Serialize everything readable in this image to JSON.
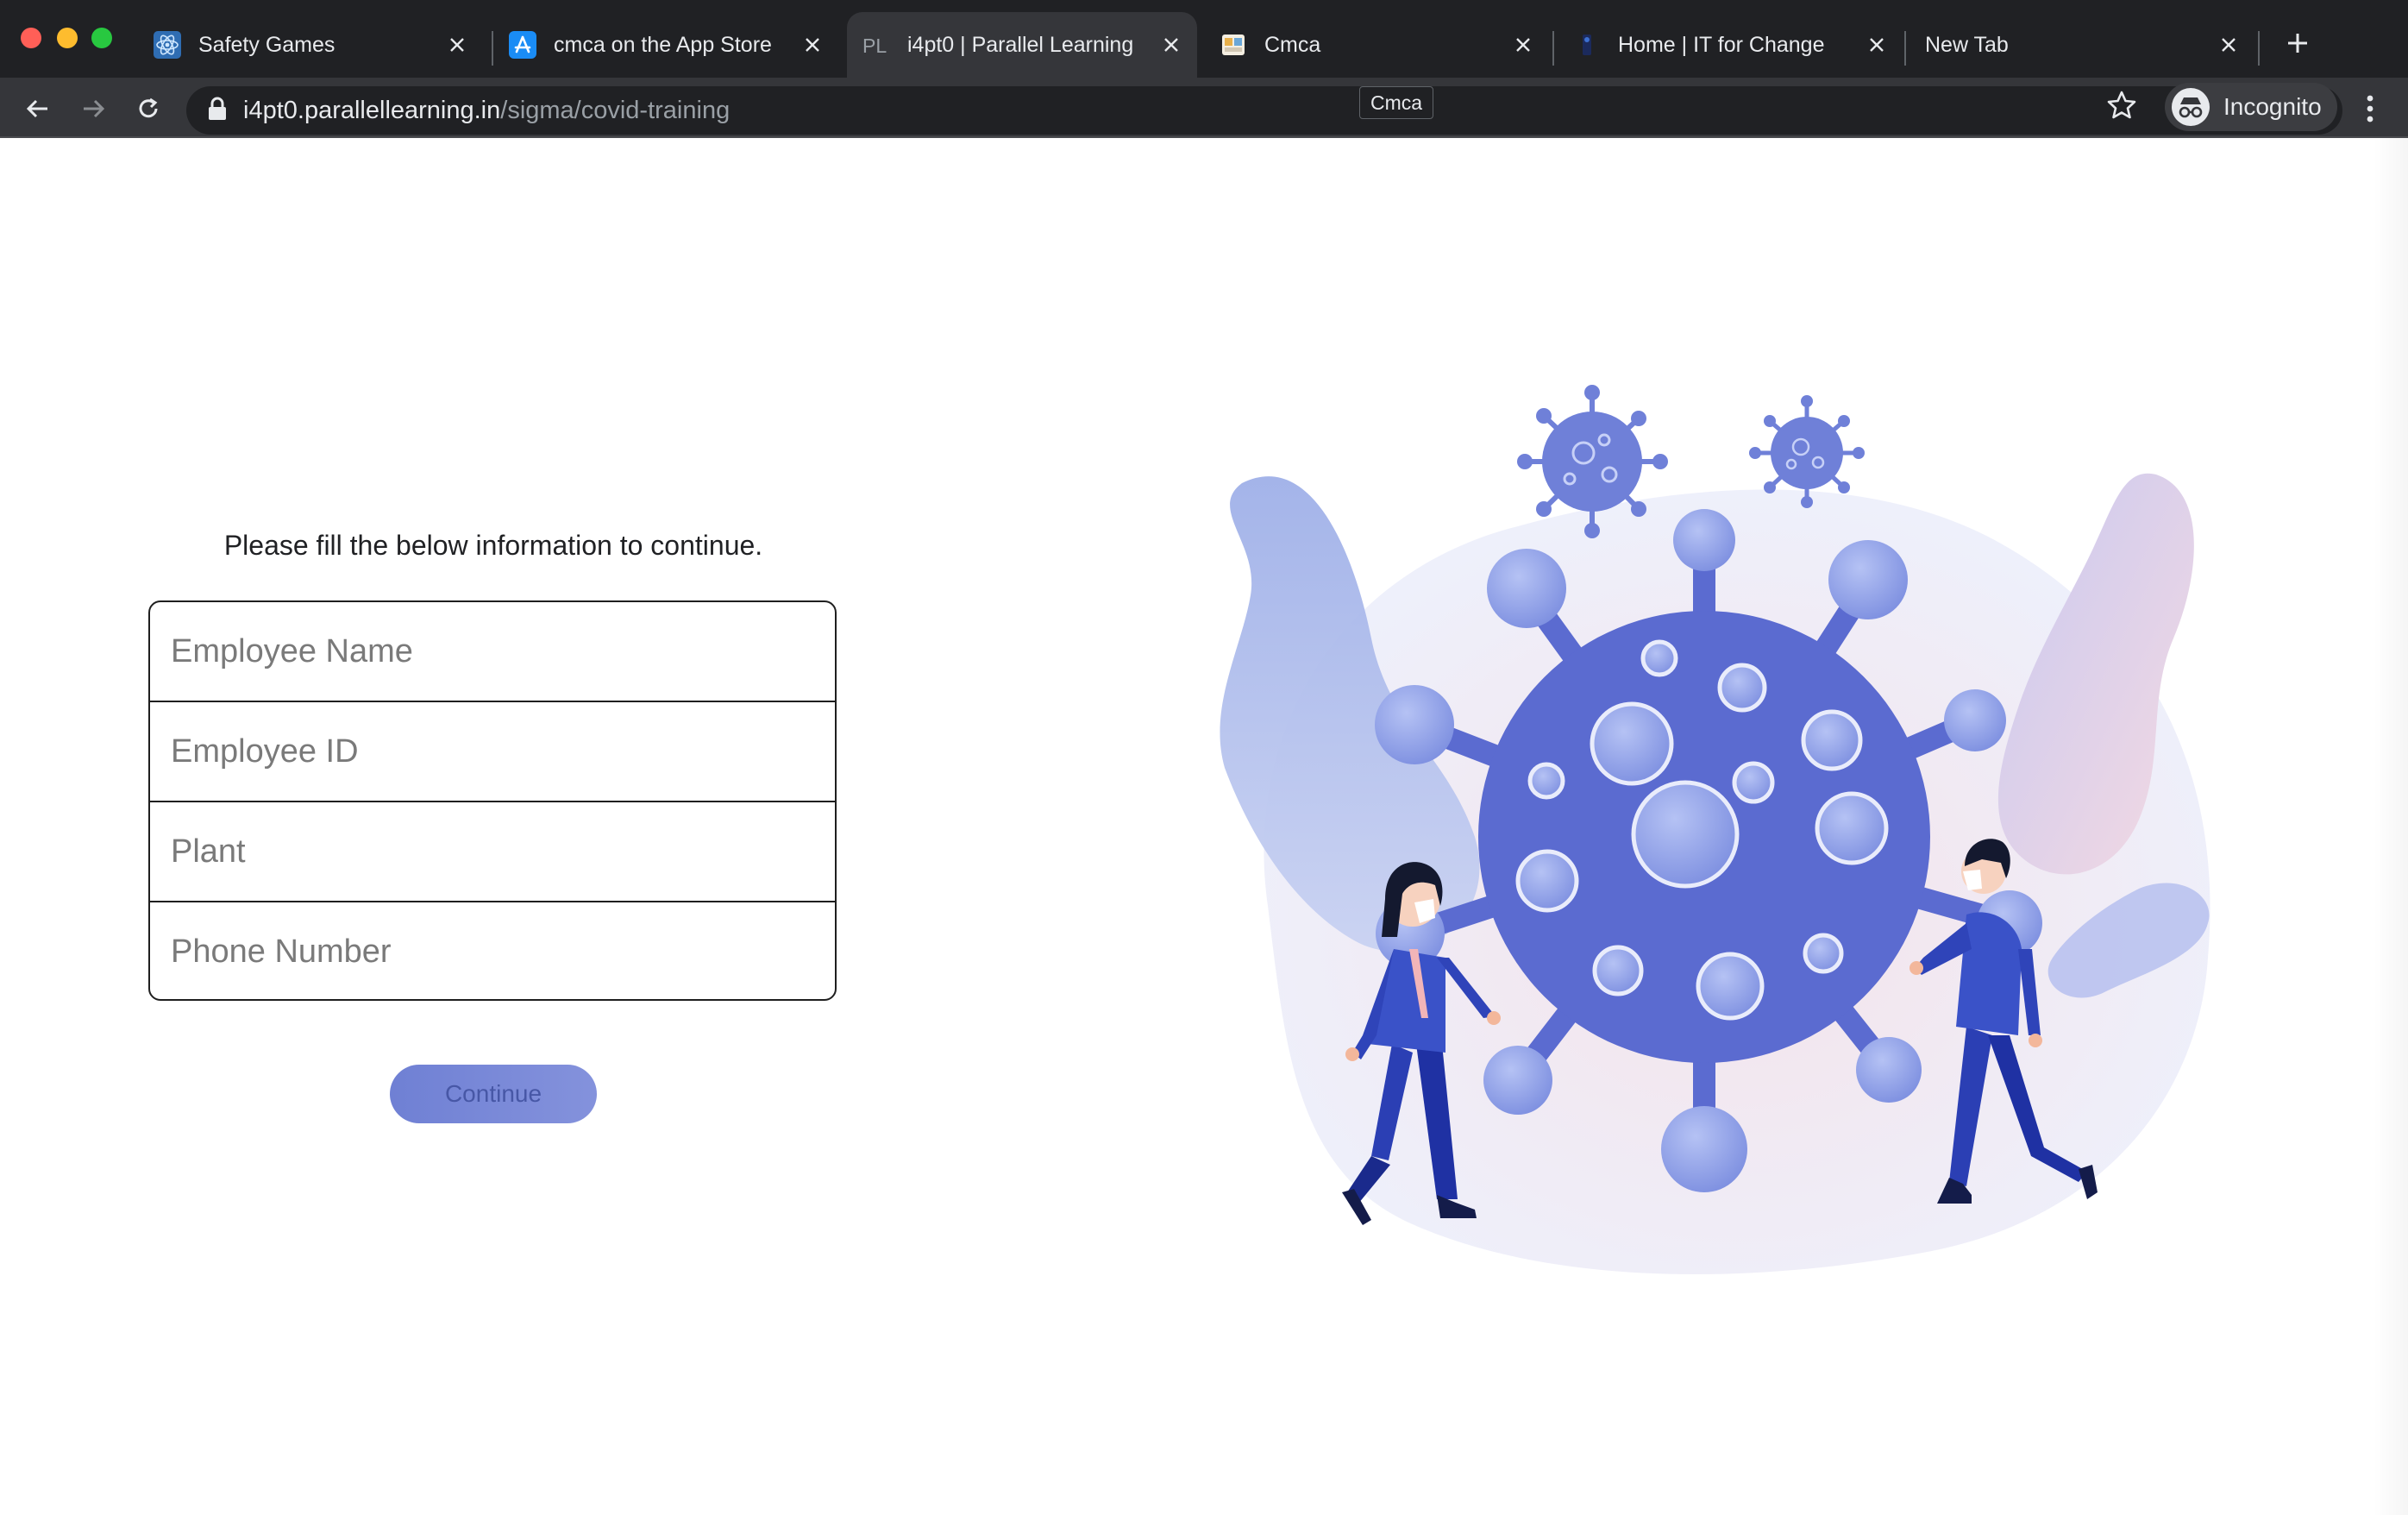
{
  "window": {
    "tabs": [
      {
        "title": "Safety Games",
        "icon": "react-icon",
        "active": false
      },
      {
        "title": "cmca on the App Store",
        "icon": "app-store-icon",
        "active": false
      },
      {
        "title": "i4pt0 | Parallel Learning",
        "icon": "parallel-learning-icon",
        "active": true
      },
      {
        "title": "Cmca",
        "icon": "cmca-icon",
        "active": false
      },
      {
        "title": "Home | IT for Change",
        "icon": "itforchange-icon",
        "active": false
      },
      {
        "title": "New Tab",
        "icon": "",
        "active": false
      }
    ],
    "tooltip": "Cmca"
  },
  "address_bar": {
    "host": "i4pt0.parallellearning.in",
    "path": "/sigma/covid-training"
  },
  "profile": {
    "label": "Incognito"
  },
  "form": {
    "instruction": "Please fill the below information to continue.",
    "fields": [
      {
        "placeholder": "Employee Name",
        "value": ""
      },
      {
        "placeholder": "Employee ID",
        "value": ""
      },
      {
        "placeholder": "Plant",
        "value": ""
      },
      {
        "placeholder": "Phone Number",
        "value": ""
      }
    ],
    "continue_label": "Continue"
  },
  "colors": {
    "accent": "#6f80d4",
    "virus": "#5b6bd0",
    "chrome_dark": "#202124"
  }
}
